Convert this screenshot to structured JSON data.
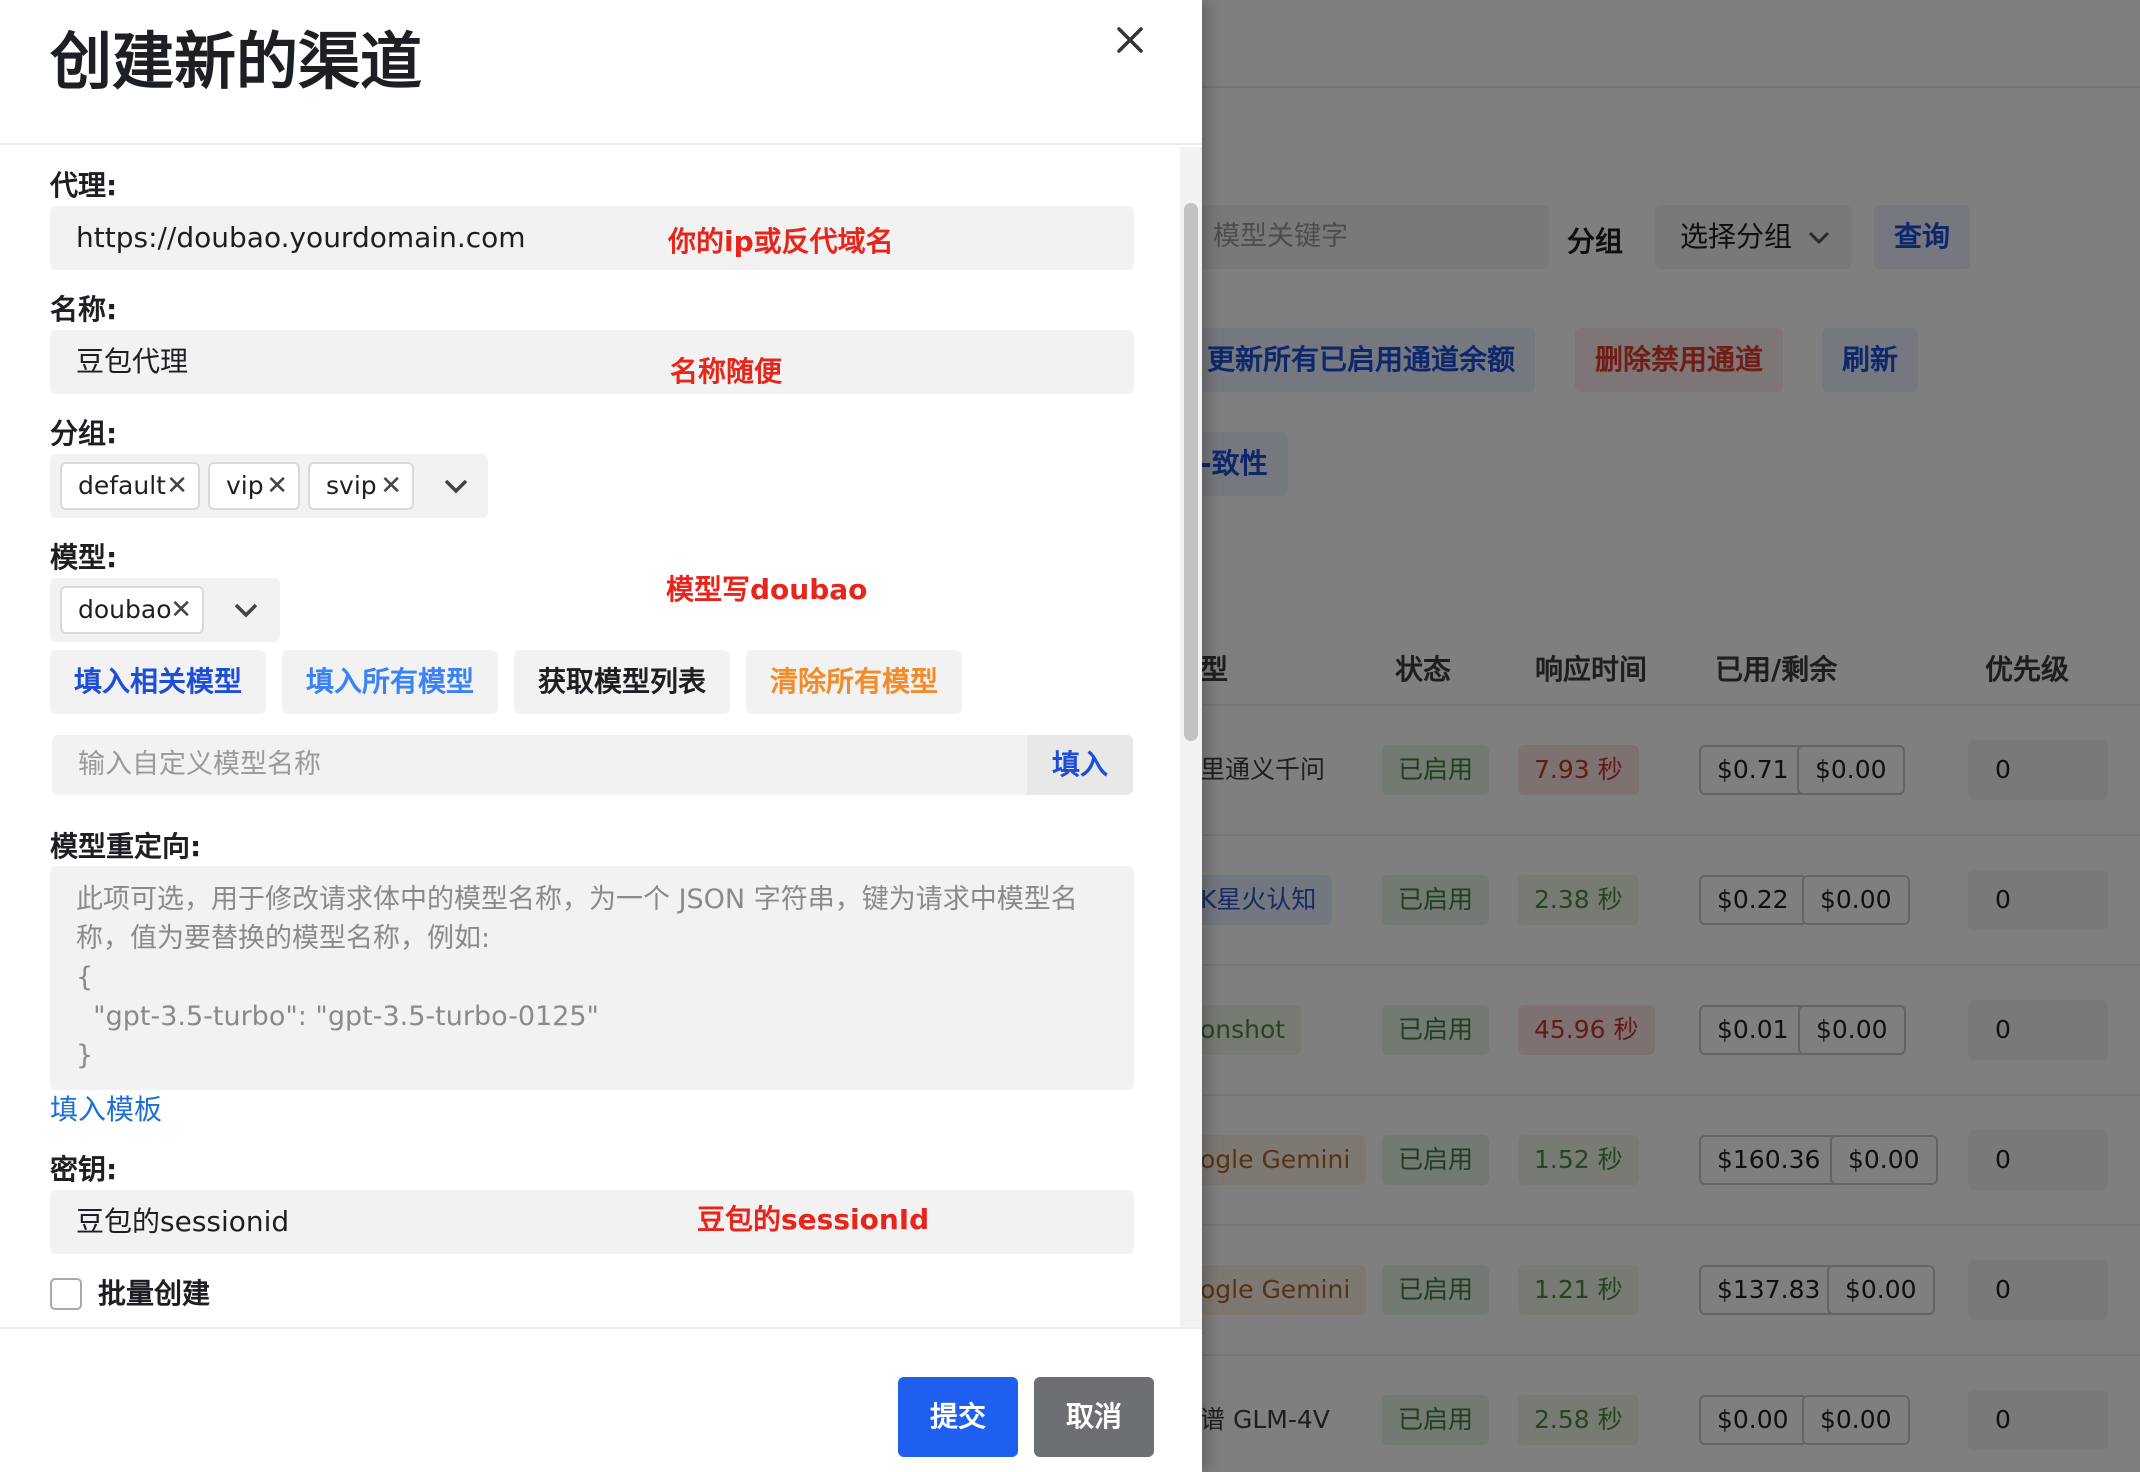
{
  "modal": {
    "title": "创建新的渠道",
    "close_icon": "close-icon",
    "proxy": {
      "label": "代理:",
      "value": "https://doubao.yourdomain.com",
      "annotation": "你的ip或反代域名"
    },
    "name": {
      "label": "名称:",
      "value": "豆包代理",
      "annotation": "名称随便"
    },
    "group": {
      "label": "分组:",
      "tags": [
        "default",
        "vip",
        "svip"
      ]
    },
    "model": {
      "label": "模型:",
      "tags": [
        "doubao"
      ],
      "annotation": "模型写doubao"
    },
    "model_buttons": {
      "fill_related": "填入相关模型",
      "fill_all": "填入所有模型",
      "fetch_list": "获取模型列表",
      "clear_all": "清除所有模型"
    },
    "custom_model": {
      "placeholder": "输入自定义模型名称",
      "button": "填入"
    },
    "model_mapping": {
      "label": "模型重定向:",
      "placeholder": "此项可选，用于修改请求体中的模型名称，为一个 JSON 字符串，键为请求中模型名称，值为要替换的模型名称，例如:\n{\n  \"gpt-3.5-turbo\": \"gpt-3.5-turbo-0125\"\n}",
      "template_link": "填入模板"
    },
    "key": {
      "label": "密钥:",
      "value": "豆包的sessionid",
      "annotation": "豆包的sessionId"
    },
    "batch_create": {
      "label": "批量创建",
      "checked": false
    },
    "submit": "提交",
    "cancel": "取消"
  },
  "background": {
    "search_placeholder": "模型关键字",
    "group_label": "分组",
    "group_select": "选择分组",
    "query_button": "查询",
    "update_balance_button": "更新所有已启用通道余额",
    "delete_disabled_button": "删除禁用通道",
    "refresh_button": "刷新",
    "consistency_button_partial": "-致性",
    "columns": [
      "型",
      "状态",
      "响应时间",
      "已用/剩余",
      "优先级"
    ],
    "rows": [
      {
        "name": "里通义千问",
        "status": "已启用",
        "time": "7.93 秒",
        "time_level": "slow",
        "used": "$0.71",
        "remaining": "$0.00",
        "priority": "0",
        "tag": "none"
      },
      {
        "name": "K星火认知",
        "status": "已启用",
        "time": "2.38 秒",
        "time_level": "fast",
        "used": "$0.22",
        "remaining": "$0.00",
        "priority": "0",
        "tag": "blue"
      },
      {
        "name": "onshot",
        "status": "已启用",
        "time": "45.96 秒",
        "time_level": "slow",
        "used": "$0.01",
        "remaining": "$0.00",
        "priority": "0",
        "tag": "green"
      },
      {
        "name": "ogle Gemini",
        "status": "已启用",
        "time": "1.52 秒",
        "time_level": "fast",
        "used": "$160.36",
        "remaining": "$0.00",
        "priority": "0",
        "tag": "orange"
      },
      {
        "name": "ogle Gemini",
        "status": "已启用",
        "time": "1.21 秒",
        "time_level": "fast",
        "used": "$137.83",
        "remaining": "$0.00",
        "priority": "0",
        "tag": "orange"
      },
      {
        "name": "谱 GLM-4V",
        "status": "已启用",
        "time": "2.58 秒",
        "time_level": "fast",
        "used": "$0.00",
        "remaining": "$0.00",
        "priority": "0",
        "tag": "none"
      }
    ]
  },
  "colors": {
    "primary": "#1f5ff0",
    "link": "#1d6fd8",
    "annotation": "#e8251b",
    "clear_button": "#f08c2a",
    "cancel": "#6c7075"
  }
}
